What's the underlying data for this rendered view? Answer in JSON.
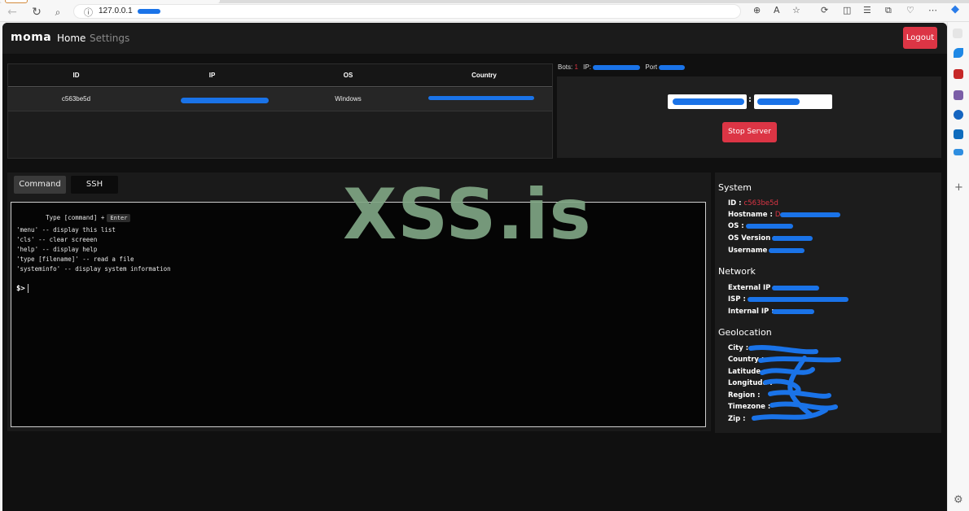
{
  "browser": {
    "url": "127.0.0.1",
    "back_icon": "arrow-left",
    "refresh_icon": "refresh",
    "search_icon": "magnifier"
  },
  "app": {
    "brand": "moma",
    "nav": {
      "home": "Home",
      "settings": "Settings"
    },
    "logout_label": "Logout"
  },
  "bots_table": {
    "columns": [
      "ID",
      "IP",
      "OS",
      "Country"
    ],
    "rows": [
      {
        "id": "c563be5d",
        "ip": "",
        "os": "Windows",
        "country": ""
      }
    ]
  },
  "server": {
    "bots_label": "Bots:",
    "bots_count": "1",
    "ip_label": "IP:",
    "port_label": "Port",
    "stop_label": "Stop Server"
  },
  "console": {
    "tabs": [
      "Command",
      "SSH"
    ],
    "hint_prefix": "Type [command] +",
    "hint_key": "Enter",
    "help_lines": [
      "'menu' -- display this list",
      "'cls' -- clear screeen",
      "'help' -- display help",
      "'type [filename]' -- read a file",
      "'systeminfo' -- display system information"
    ],
    "prompt": "$>"
  },
  "system_info": {
    "system_title": "System",
    "id_label": "ID :",
    "id_value": "c563be5d",
    "hostname_label": "Hostname :",
    "hostname_value": "D",
    "os_label": "OS :",
    "os_version_label": "OS Version :",
    "username_label": "Username :",
    "network_title": "Network",
    "external_ip_label": "External IP :",
    "isp_label": "ISP :",
    "internal_ip_label": "Internal IP :",
    "geolocation_title": "Geolocation",
    "city_label": "City :",
    "country_label": "Country :",
    "latitude_label": "Latitude :",
    "longitude_label": "Longitude :",
    "region_label": "Region :",
    "timezone_label": "Timezone :",
    "zip_label": "Zip :"
  },
  "watermark": "XSS.is",
  "colors": {
    "accent": "#dc3545",
    "redaction": "#1a73e8",
    "watermark": "#7fa584"
  }
}
